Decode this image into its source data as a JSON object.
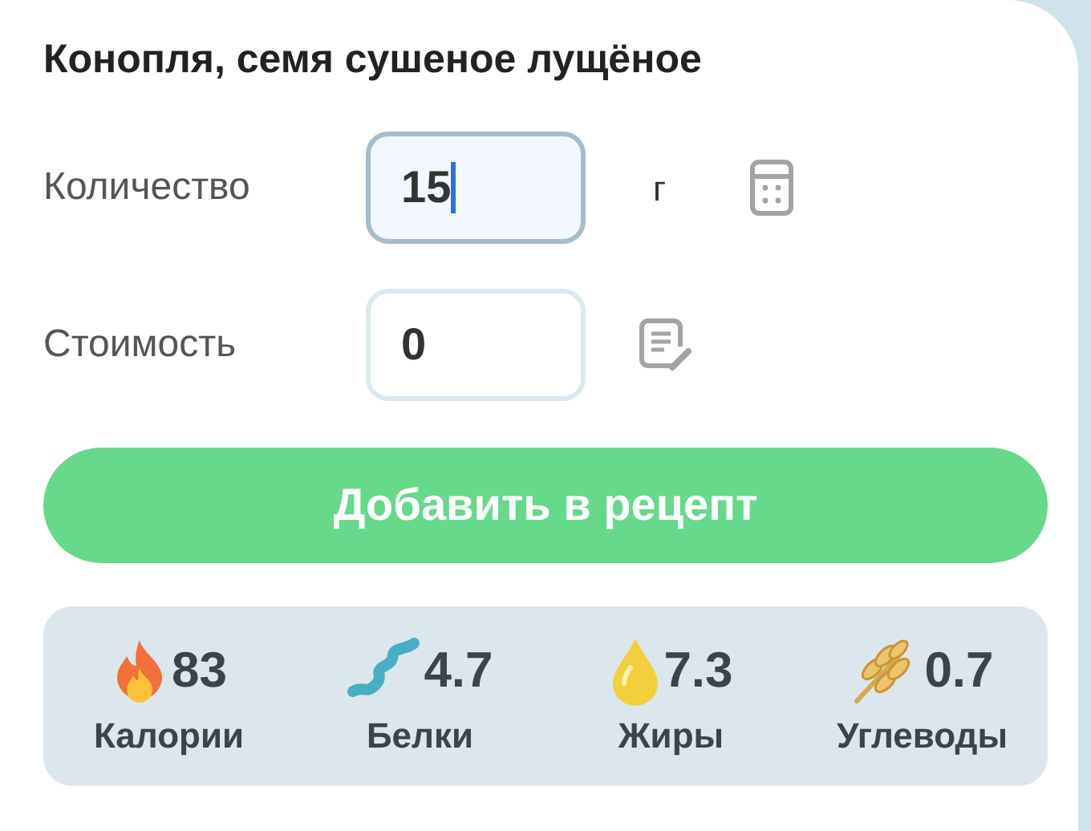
{
  "title": "Конопля, семя сушеное лущёное",
  "fields": [
    {
      "label": "Количество",
      "value": "15",
      "focused": true,
      "unit": "г",
      "kind": "calculator"
    },
    {
      "label": "Стоимость",
      "value": "0",
      "focused": false,
      "kind": "note"
    }
  ],
  "add_button": "Добавить в рецепт",
  "nutrients": [
    {
      "kind": "fire",
      "value": "83",
      "label": "Калории"
    },
    {
      "kind": "helix",
      "value": "4.7",
      "label": "Белки"
    },
    {
      "kind": "drop",
      "value": "7.3",
      "label": "Жиры"
    },
    {
      "kind": "wheat",
      "value": "0.7",
      "label": "Углеводы"
    }
  ]
}
